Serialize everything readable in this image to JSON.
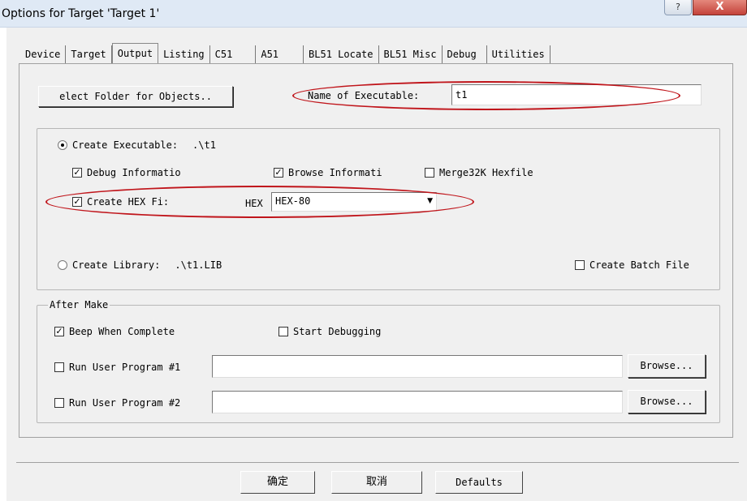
{
  "window": {
    "title": "Options for Target 'Target 1'",
    "help_label": "?",
    "close_label": "X"
  },
  "tabs": [
    {
      "label": "Device"
    },
    {
      "label": "Target"
    },
    {
      "label": "Output"
    },
    {
      "label": "Listing"
    },
    {
      "label": "C51"
    },
    {
      "label": "A51"
    },
    {
      "label": "BL51 Locate"
    },
    {
      "label": "BL51 Misc"
    },
    {
      "label": "Debug"
    },
    {
      "label": "Utilities"
    }
  ],
  "output": {
    "select_folder_label": "elect Folder for Objects..",
    "name_exe_label": "Name of Executable:",
    "name_exe_value": "t1",
    "create_exe_label": "Create Executable:",
    "create_exe_path": ".\\t1",
    "debug_info_label": "Debug Informatio",
    "browse_info_label": "Browse Informati",
    "merge_label": "Merge32K Hexfile",
    "create_hex_label": "Create HEX Fi:",
    "hex_label": "HEX",
    "hex_format": "HEX-80",
    "create_lib_label": "Create Library:",
    "create_lib_path": ".\\t1.LIB",
    "create_batch_label": "Create Batch File"
  },
  "after_make": {
    "legend": "After Make",
    "beep_label": "Beep When Complete",
    "start_debug_label": "Start Debugging",
    "run1_label": "Run User Program #1",
    "run1_value": "",
    "run2_label": "Run User Program #2",
    "run2_value": "",
    "browse_label": "Browse..."
  },
  "footer": {
    "ok_label": "确定",
    "cancel_label": "取消",
    "defaults_label": "Defaults"
  },
  "states": {
    "create_executable": true,
    "debug_info": true,
    "browse_info": true,
    "merge32k": false,
    "create_hex": true,
    "create_library": false,
    "create_batch": false,
    "beep": true,
    "start_debugging": false,
    "run1": false,
    "run2": false
  },
  "colors": {
    "highlight_oval": "#c0151b",
    "dialog_bg": "#f0f0f0",
    "titlebar_bg": "#dfe9f5"
  }
}
